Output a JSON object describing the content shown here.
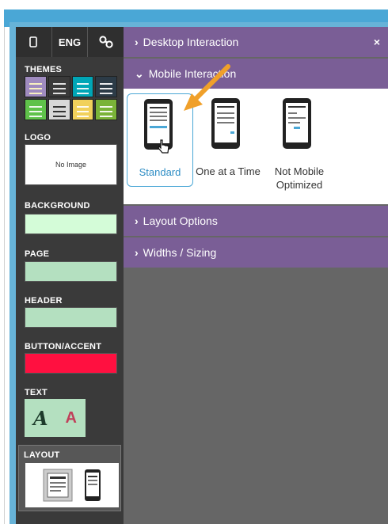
{
  "sidebar": {
    "tabs": [
      {
        "icon": "phone-icon",
        "label": ""
      },
      {
        "icon": "",
        "label": "ENG"
      },
      {
        "icon": "link-icon",
        "label": ""
      }
    ],
    "sections": {
      "themes": "THEMES",
      "logo": "LOGO",
      "logo_placeholder": "No Image",
      "background": "BACKGROUND",
      "page": "PAGE",
      "header": "HEADER",
      "button_accent": "BUTTON/ACCENT",
      "text": "TEXT",
      "layout": "LAYOUT"
    },
    "text_glyphs": {
      "script": "A",
      "sans": "A"
    },
    "colors": {
      "background": "#d4fcd8",
      "page": "#b4e0c0",
      "header": "#b4e0c0",
      "button_accent": "#ff1040",
      "sans_glyph": "#c0405a"
    },
    "themes": [
      {
        "bg": "#9f8bbf",
        "bars": "#f7f0c0"
      },
      {
        "bg": "#3a3a3a",
        "bars": "#e0e0e0"
      },
      {
        "bg": "#00a6b6",
        "bars": "#ffffff"
      },
      {
        "bg": "#2c3b47",
        "bars": "#ffffff"
      },
      {
        "bg": "#5fc24a",
        "bars": "#ffffff"
      },
      {
        "bg": "#d8d8d8",
        "bars": "#333333"
      },
      {
        "bg": "#f1d15b",
        "bars": "#ffffff"
      },
      {
        "bg": "#7ab338",
        "bars": "#ffffff"
      }
    ]
  },
  "panel": {
    "desktop_interaction": "Desktop Interaction",
    "mobile_interaction": "Mobile Interaction",
    "layout_options": "Layout Options",
    "widths_sizing": "Widths / Sizing",
    "close_glyph": "×",
    "options": [
      {
        "label": "Standard",
        "selected": true
      },
      {
        "label": "One at a Time",
        "selected": false
      },
      {
        "label": "Not Mobile Optimized",
        "selected": false
      }
    ]
  },
  "annotation": {
    "arrow_color": "#f0a02a"
  }
}
